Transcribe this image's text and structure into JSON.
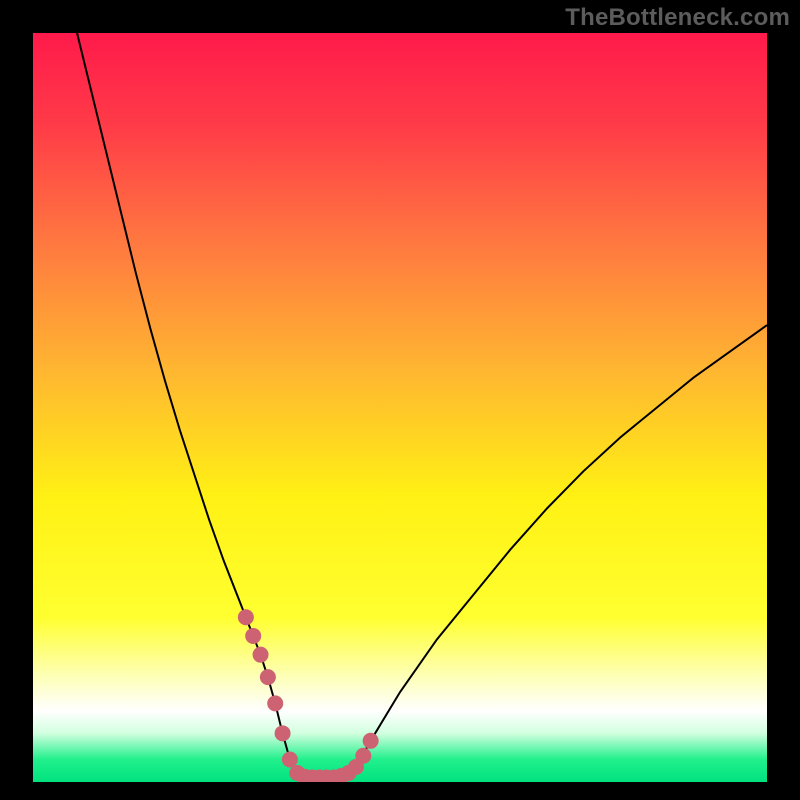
{
  "watermark": "TheBottleneck.com",
  "colors": {
    "frame": "#000000",
    "curve_stroke": "#000000",
    "marker_fill": "#cc6272",
    "gradient_stops": [
      {
        "offset": 0.0,
        "color": "#ff1a4b"
      },
      {
        "offset": 0.12,
        "color": "#ff3a48"
      },
      {
        "offset": 0.28,
        "color": "#ff7840"
      },
      {
        "offset": 0.45,
        "color": "#ffb631"
      },
      {
        "offset": 0.62,
        "color": "#fff114"
      },
      {
        "offset": 0.78,
        "color": "#ffff30"
      },
      {
        "offset": 0.86,
        "color": "#fdffb8"
      },
      {
        "offset": 0.905,
        "color": "#ffffff"
      },
      {
        "offset": 0.935,
        "color": "#d1ffdf"
      },
      {
        "offset": 0.97,
        "color": "#21f08c"
      },
      {
        "offset": 1.0,
        "color": "#00e27e"
      }
    ]
  },
  "chart_data": {
    "type": "line",
    "title": "",
    "xlabel": "",
    "ylabel": "",
    "xlim": [
      0,
      100
    ],
    "ylim": [
      0,
      100
    ],
    "grid": false,
    "legend": false,
    "series": [
      {
        "name": "bottleneck-curve",
        "x": [
          6,
          8,
          10,
          12,
          14,
          16,
          18,
          20,
          22,
          24,
          26,
          28,
          29,
          30,
          31,
          32,
          33,
          34,
          35,
          36,
          38,
          40,
          42,
          44,
          46,
          50,
          55,
          60,
          65,
          70,
          75,
          80,
          85,
          90,
          95,
          100
        ],
        "values": [
          100,
          92,
          84,
          76,
          68,
          60.5,
          53.5,
          47,
          41,
          35,
          29.5,
          24.5,
          22,
          19.5,
          17,
          14,
          10.5,
          6.5,
          3,
          1.2,
          0.6,
          0.6,
          0.8,
          2,
          5.5,
          12,
          19,
          25,
          31,
          36.5,
          41.5,
          46,
          50,
          54,
          57.5,
          61
        ]
      }
    ],
    "markers": {
      "name": "highlighted-points",
      "x": [
        29,
        30,
        31,
        32,
        33,
        34,
        35,
        36,
        37,
        38,
        39,
        40,
        41,
        42,
        43,
        44,
        45,
        46
      ],
      "values": [
        22,
        19.5,
        17,
        14,
        10.5,
        6.5,
        3,
        1.2,
        0.7,
        0.6,
        0.6,
        0.6,
        0.6,
        0.8,
        1.2,
        2,
        3.5,
        5.5
      ]
    }
  }
}
